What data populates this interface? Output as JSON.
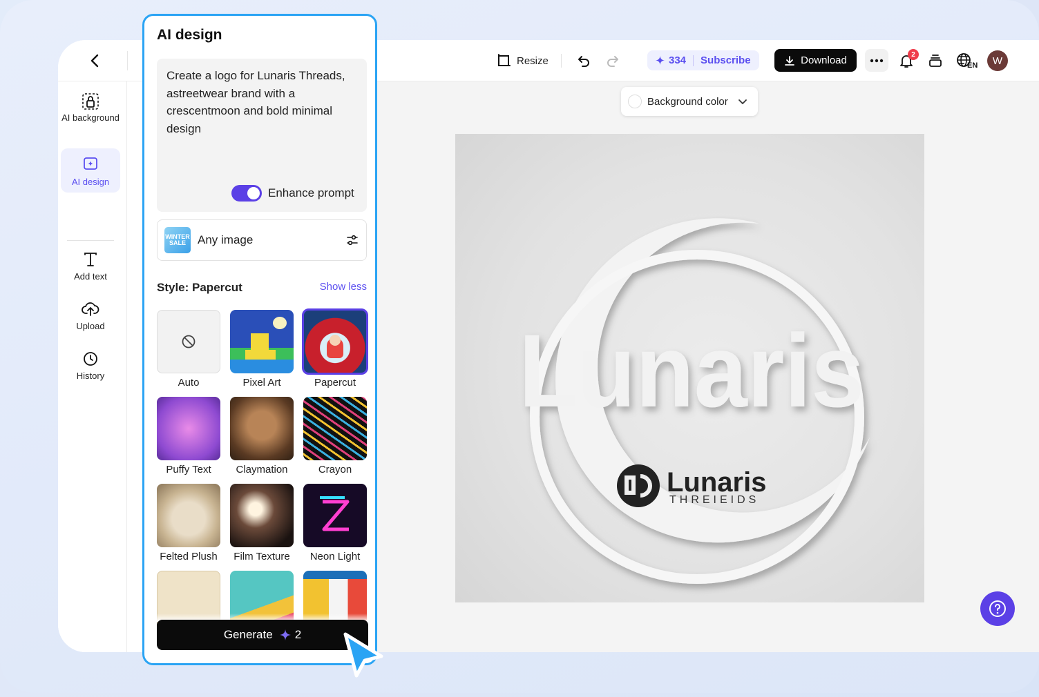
{
  "topbar": {
    "resize_label": "Resize",
    "credits": "334",
    "subscribe_label": "Subscribe",
    "download_label": "Download",
    "notification_count": "2",
    "language": "EN",
    "avatar_initial": "W"
  },
  "sidebar": {
    "items": [
      {
        "label": "AI background",
        "icon": "ai-background-icon"
      },
      {
        "label": "AI design",
        "icon": "ai-design-icon",
        "active": true
      },
      {
        "label": "Add text",
        "icon": "text-icon"
      },
      {
        "label": "Upload",
        "icon": "upload-icon"
      },
      {
        "label": "History",
        "icon": "clock-icon"
      }
    ]
  },
  "canvas": {
    "background_color_label": "Background color",
    "logo_main_text": "Lunaris",
    "logo_badge_text": "Lunaris",
    "logo_sub_text": "THREIEIDS"
  },
  "panel": {
    "title": "AI design",
    "prompt_text": "Create a logo for Lunaris Threads, astreetwear brand with a crescentmoon and bold minimal design",
    "enhance_label": "Enhance prompt",
    "enhance_on": true,
    "image_type_label": "Any image",
    "image_type_thumb_text": "WINTER SALE",
    "style_title": "Style: Papercut",
    "show_less_label": "Show less",
    "styles": [
      {
        "label": "Auto"
      },
      {
        "label": "Pixel Art"
      },
      {
        "label": "Papercut",
        "selected": true
      },
      {
        "label": "Puffy Text"
      },
      {
        "label": "Claymation"
      },
      {
        "label": "Crayon"
      },
      {
        "label": "Felted Plush"
      },
      {
        "label": "Film Texture"
      },
      {
        "label": "Neon Light"
      },
      {
        "label": ""
      },
      {
        "label": ""
      },
      {
        "label": ""
      }
    ],
    "generate_label": "Generate",
    "generate_cost": "2"
  },
  "colors": {
    "accent": "#5b40e6",
    "panel_border": "#2ba4f4",
    "badge": "#ef3d4b"
  }
}
